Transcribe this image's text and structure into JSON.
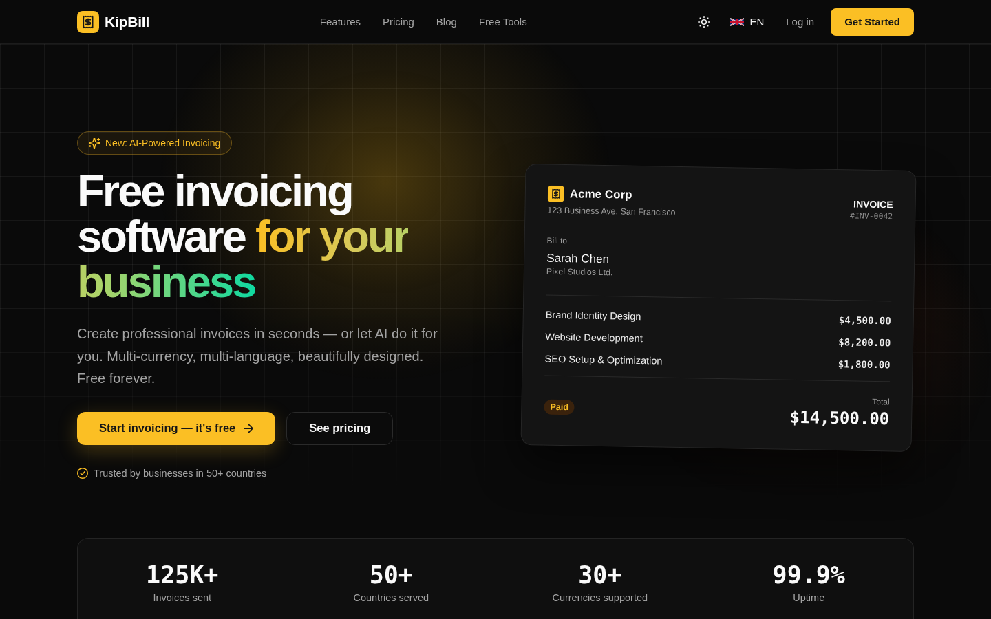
{
  "nav": {
    "brand": "KipBill",
    "links": [
      "Features",
      "Pricing",
      "Blog",
      "Free Tools"
    ],
    "language": "EN",
    "login": "Log in",
    "cta": "Get Started"
  },
  "hero": {
    "badge": "New: AI-Powered Invoicing",
    "headline": "Free invoicing software",
    "headline_highlight": "for your business",
    "subtitle": "Create professional invoices in seconds — or let AI do it for you. Multi-currency, multi-language, beautifully designed. Free forever.",
    "primary_button": "Start invoicing — it's free",
    "secondary_button": "See pricing",
    "trust": "Trusted by businesses in 50+ countries"
  },
  "invoice": {
    "company": "Acme Corp",
    "address": "123 Business Ave, San Francisco",
    "title": "INVOICE",
    "number": "#INV-0042",
    "bill_to_label": "Bill to",
    "client": "Sarah Chen",
    "client_company": "Pixel Studios Ltd.",
    "items": [
      {
        "description": "Brand Identity Design",
        "amount": "$4,500.00"
      },
      {
        "description": "Website Development",
        "amount": "$8,200.00"
      },
      {
        "description": "SEO Setup & Optimization",
        "amount": "$1,800.00"
      }
    ],
    "status": "Paid",
    "total_label": "Total",
    "total": "$14,500.00"
  },
  "stats": [
    {
      "value": "125K+",
      "label": "Invoices sent"
    },
    {
      "value": "50+",
      "label": "Countries served"
    },
    {
      "value": "30+",
      "label": "Currencies supported"
    },
    {
      "value": "99.9%",
      "label": "Uptime"
    }
  ]
}
